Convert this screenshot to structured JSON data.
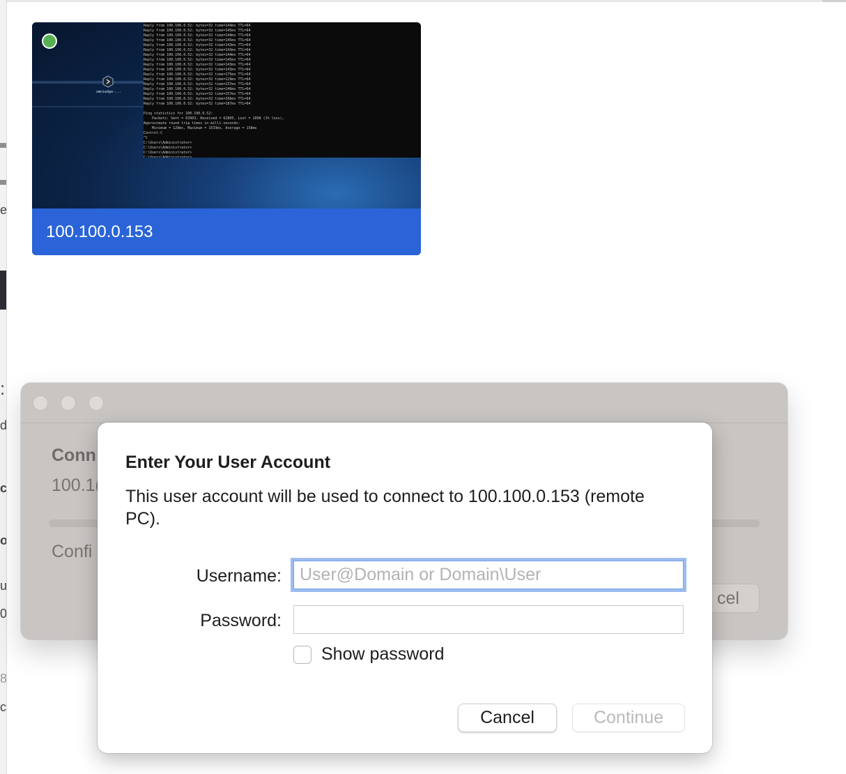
{
  "machine_card": {
    "title": "100.100.0.153",
    "status": "online",
    "status_color": "#58b053",
    "desktop_icon_label": "omniedge-...",
    "terminal_lines": [
      "Reply from 100.100.0.52: bytes=32 time=144ms TTL=64",
      "Reply from 100.100.0.52: bytes=32 time=145ms TTL=64",
      "Reply from 100.100.0.52: bytes=32 time=144ms TTL=64",
      "Reply from 100.100.0.52: bytes=32 time=145ms TTL=64",
      "Reply from 100.100.0.52: bytes=32 time=143ms TTL=64",
      "Reply from 100.100.0.52: bytes=32 time=143ms TTL=64",
      "Reply from 100.100.0.52: bytes=32 time=144ms TTL=64",
      "Reply from 100.100.0.52: bytes=32 time=145ms TTL=64",
      "Reply from 100.100.0.52: bytes=32 time=143ms TTL=64",
      "Reply from 100.100.0.52: bytes=32 time=143ms TTL=64",
      "Reply from 100.100.0.52: bytes=32 time=175ms TTL=64",
      "Reply from 100.100.0.52: bytes=32 time=229ms TTL=64",
      "Reply from 100.100.0.52: bytes=32 time=237ms TTL=64",
      "Reply from 100.100.0.52: bytes=32 time=246ms TTL=64",
      "Reply from 100.100.0.52: bytes=32 time=257ms TTL=64",
      "Reply from 100.100.0.52: bytes=32 time=266ms TTL=64",
      "Reply from 100.100.0.52: bytes=32 time=187ms TTL=64",
      "",
      "Ping statistics for 100.100.0.52:",
      "    Packets: Sent = 63903, Received = 62805, Lost = 1098 (1% loss),",
      "Approximate round trip times in milli-seconds:",
      "    Minimum = 128ms, Maximum = 1533ms, Average = 158ms",
      "Control-C",
      "^C",
      "C:\\Users\\Administrator>",
      "C:\\Users\\Administrator>",
      "C:\\Users\\Administrator>",
      "C:\\Users\\Administrator>"
    ]
  },
  "connecting_window": {
    "heading": "Conn",
    "ip": "100.1(",
    "confirm_text": "Confi",
    "cancel_label": "cel"
  },
  "left_edge_fragments": [
    "e",
    ":",
    "d",
    "c",
    "ou",
    "ur",
    "0",
    "8",
    "cr"
  ],
  "dialog": {
    "title": "Enter Your User Account",
    "message": "This user account will be used to connect to 100.100.0.153 (remote PC).",
    "username_label": "Username:",
    "username_value": "",
    "username_placeholder": "User@Domain or Domain\\User",
    "password_label": "Password:",
    "password_value": "",
    "show_password_label": "Show password",
    "show_password_checked": false,
    "cancel_label": "Cancel",
    "continue_label": "Continue",
    "continue_enabled": false
  }
}
